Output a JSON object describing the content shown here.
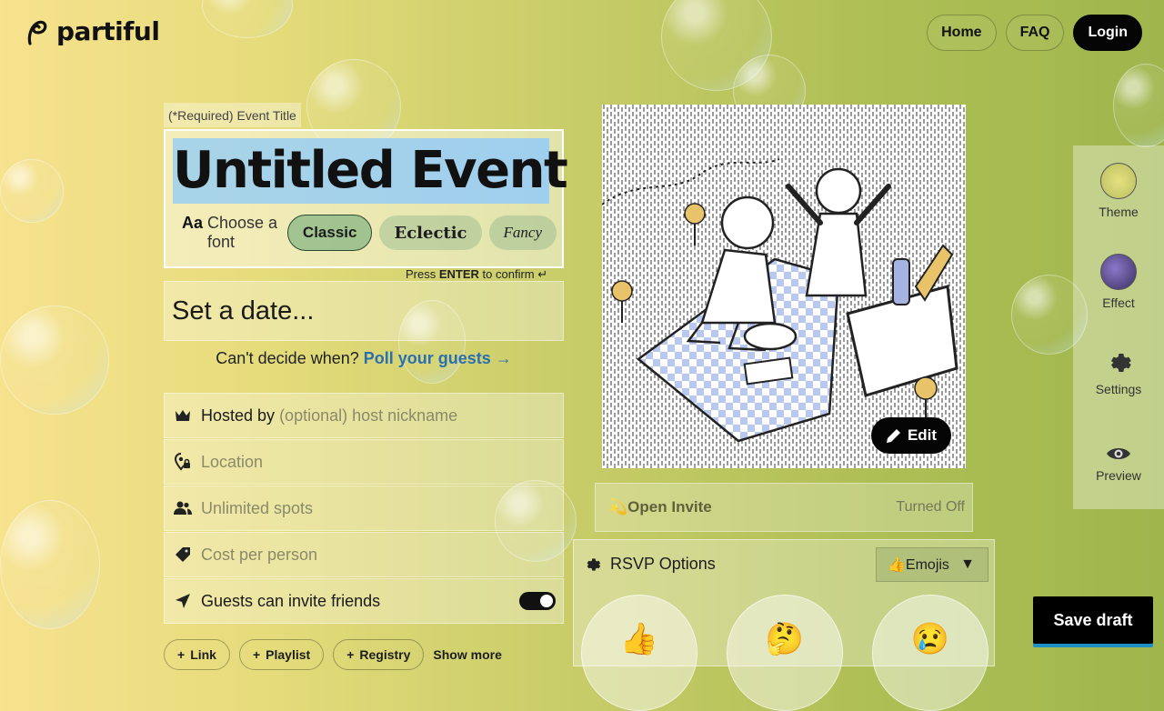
{
  "brand": {
    "name": "partiful"
  },
  "nav": {
    "home": "Home",
    "faq": "FAQ",
    "login": "Login"
  },
  "title_section": {
    "label": "(*Required) Event Title",
    "value": "Untitled Event",
    "font_prefix": "Aa",
    "font_label": "Choose a font",
    "fonts": [
      "Classic",
      "Eclectic",
      "Fancy"
    ],
    "enter_hint_prefix": "Press",
    "enter_hint_key": "ENTER",
    "enter_hint_suffix": "to confirm"
  },
  "date": {
    "placeholder": "Set a date..."
  },
  "poll": {
    "question": "Can't decide when?",
    "link": "Poll your guests →"
  },
  "fields": {
    "hosted_label": "Hosted by",
    "hosted_placeholder": "(optional) host nickname",
    "location_placeholder": "Location",
    "spots_placeholder": "Unlimited spots",
    "cost_placeholder": "Cost per person",
    "guests_invite_label": "Guests can invite friends",
    "guests_invite_enabled": true
  },
  "add_chips": {
    "link": "Link",
    "playlist": "Playlist",
    "registry": "Registry",
    "show_more": "Show more"
  },
  "poster": {
    "edit_label": "Edit"
  },
  "open_invite": {
    "label": "Open Invite",
    "status": "Turned Off"
  },
  "rsvp": {
    "title": "RSVP Options",
    "style_value": "👍Emojis",
    "options": [
      "👍",
      "🤔",
      "😢"
    ]
  },
  "sidebar": {
    "theme": "Theme",
    "effect": "Effect",
    "settings": "Settings",
    "preview": "Preview"
  },
  "save_draft": "Save draft",
  "colors": {
    "accent_blue": "#2b6fb0",
    "highlight": "#a9d4e8",
    "dark": "#050505"
  }
}
